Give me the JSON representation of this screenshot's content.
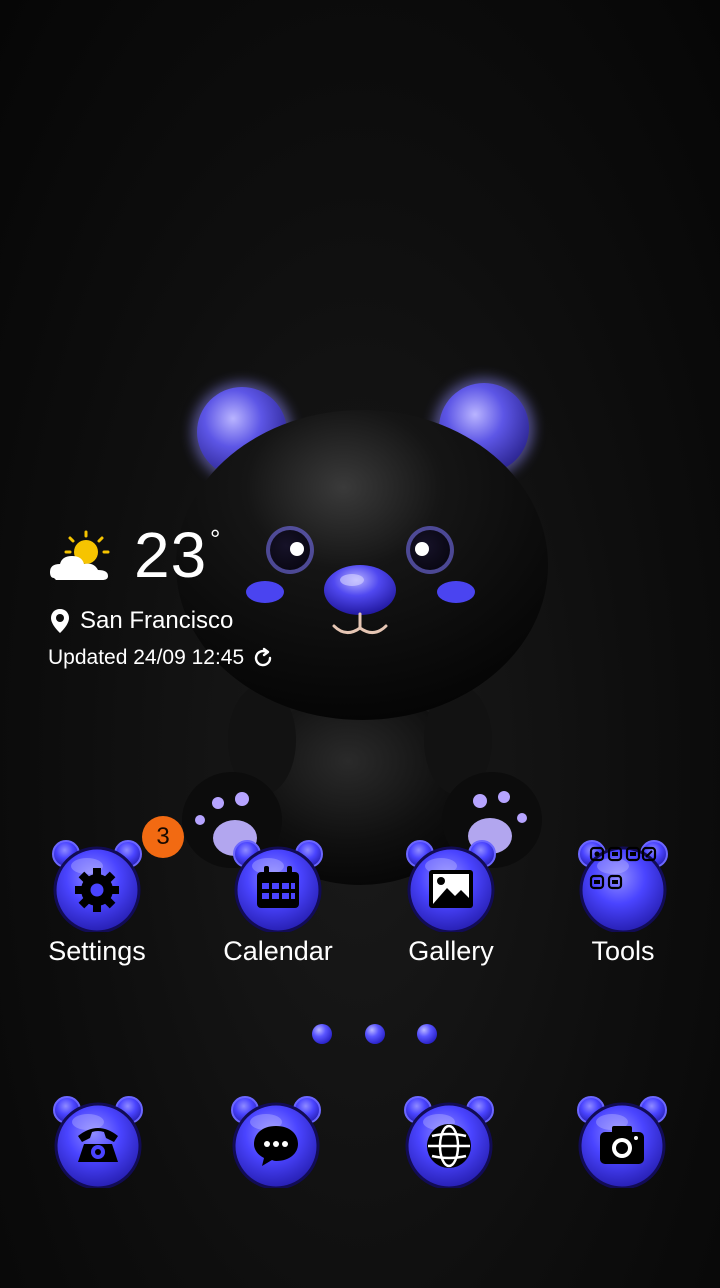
{
  "weather": {
    "temperature": "23",
    "degree_symbol": "°",
    "city": "San Francisco",
    "updated": "Updated 24/09 12:45",
    "condition_icon": "partly-sunny-icon"
  },
  "apps": [
    {
      "label": "Settings",
      "icon": "gear-icon",
      "badge": "3"
    },
    {
      "label": "Calendar",
      "icon": "calendar-icon"
    },
    {
      "label": "Gallery",
      "icon": "image-icon"
    },
    {
      "label": "Tools",
      "icon": "tools-folder-icon"
    }
  ],
  "dock": [
    {
      "icon": "phone-icon"
    },
    {
      "icon": "messages-icon"
    },
    {
      "icon": "browser-globe-icon"
    },
    {
      "icon": "camera-icon"
    }
  ],
  "page_indicator": {
    "pages": 3,
    "current": 2
  },
  "colors": {
    "accent_blue": "#4a46ff",
    "badge_orange": "#f26a12",
    "background": "#0e0e0e"
  }
}
